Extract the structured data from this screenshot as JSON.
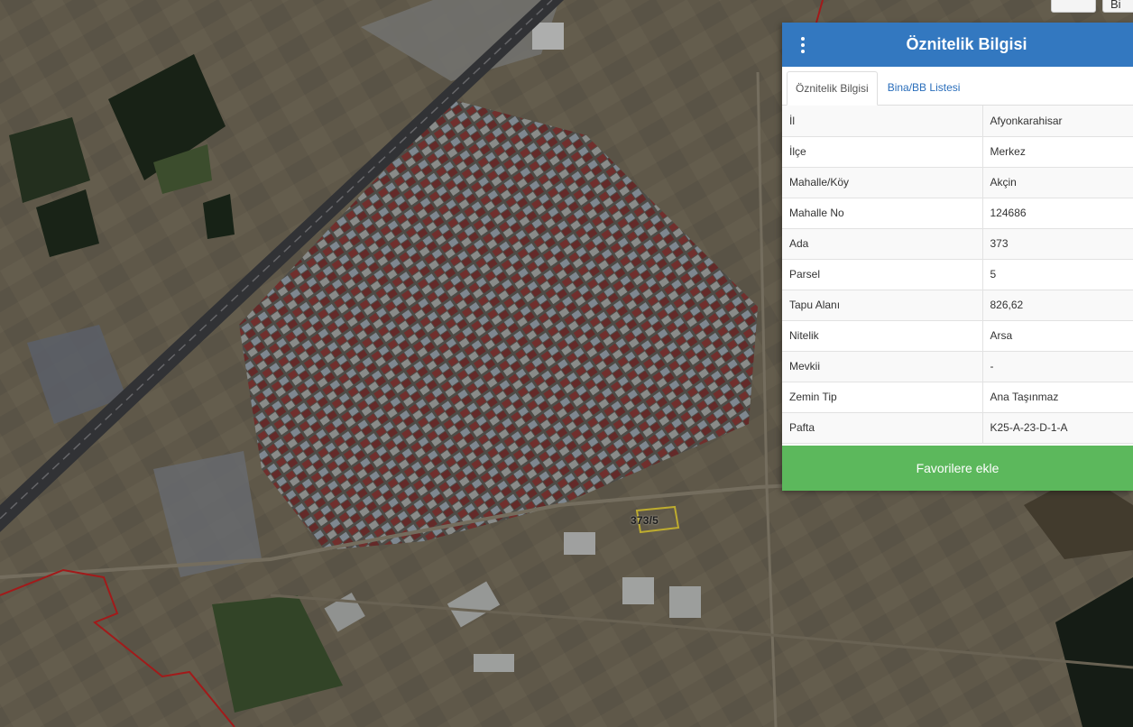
{
  "map": {
    "parcel_label": "373/5",
    "colors": {
      "ground": "#6b6555",
      "dark_field": "#1e2a1c",
      "highway": "#3c3d41",
      "boundary": "#c62020",
      "parcel_outline": "#e8d23a",
      "roof_red": "#8a3a38",
      "roof_blue": "#7d8ca0",
      "roof_grey": "#a8aaa8"
    }
  },
  "top_controls": {
    "button_1": "",
    "button_2": "Bi"
  },
  "panel": {
    "title": "Öznitelik Bilgisi",
    "menu_icon": "vertical-ellipsis-icon",
    "colors": {
      "header": "#3378c0",
      "favorite_button": "#5cb85c"
    },
    "tabs": [
      {
        "label": "Öznitelik Bilgisi",
        "active": true
      },
      {
        "label": "Bina/BB Listesi",
        "active": false
      }
    ],
    "attributes": [
      {
        "key": "İl",
        "value": "Afyonkarahisar"
      },
      {
        "key": "İlçe",
        "value": "Merkez"
      },
      {
        "key": "Mahalle/Köy",
        "value": "Akçin"
      },
      {
        "key": "Mahalle No",
        "value": "124686"
      },
      {
        "key": "Ada",
        "value": "373"
      },
      {
        "key": "Parsel",
        "value": "5"
      },
      {
        "key": "Tapu Alanı",
        "value": "826,62"
      },
      {
        "key": "Nitelik",
        "value": "Arsa"
      },
      {
        "key": "Mevkii",
        "value": "-"
      },
      {
        "key": "Zemin Tip",
        "value": "Ana Taşınmaz"
      },
      {
        "key": "Pafta",
        "value": "K25-A-23-D-1-A"
      }
    ],
    "favorite_button": "Favorilere ekle"
  }
}
